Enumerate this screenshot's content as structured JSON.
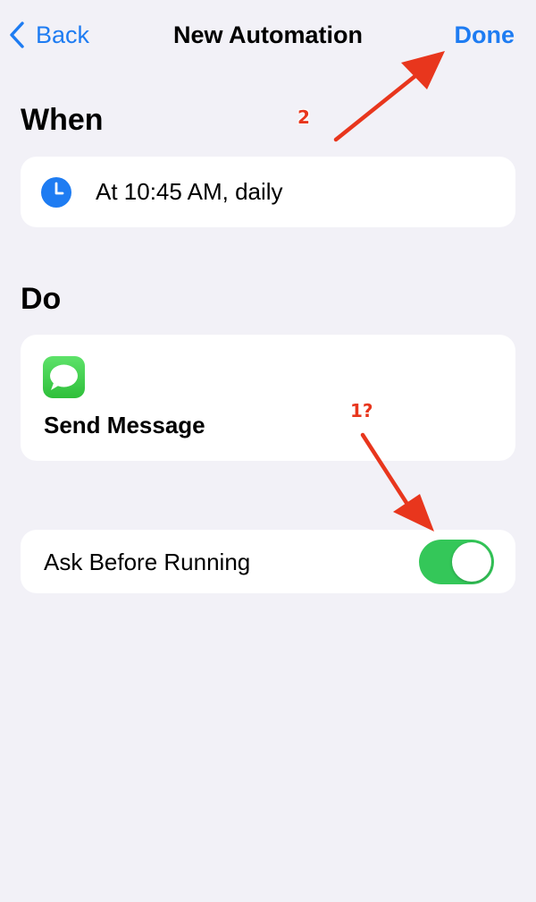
{
  "nav": {
    "back_label": "Back",
    "title": "New Automation",
    "done_label": "Done"
  },
  "when": {
    "section_title": "When",
    "trigger_label": "At 10:45 AM, daily",
    "icon": "clock-icon"
  },
  "do": {
    "section_title": "Do",
    "action_label": "Send Message",
    "icon": "messages-icon"
  },
  "ask_before_running": {
    "label": "Ask Before Running",
    "enabled": true
  },
  "annotations": {
    "done_marker": "2",
    "toggle_marker": "1?"
  },
  "colors": {
    "accent": "#1e7cf2",
    "toggle_on": "#34c759",
    "annotation": "#e8361d",
    "background": "#f2f1f7"
  }
}
